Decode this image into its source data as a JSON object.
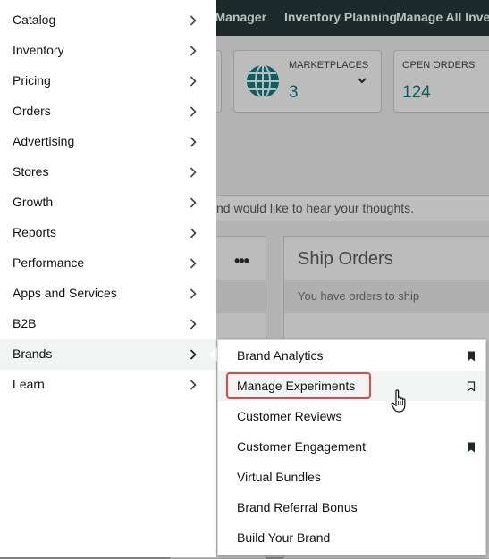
{
  "top_nav": {
    "items": [
      "n Manager",
      "Inventory Planning",
      "Manage All Invent"
    ]
  },
  "cards": [
    {
      "label": "MARKETPLACES",
      "value": "3",
      "icon": "globe-icon"
    },
    {
      "label": "OPEN ORDERS",
      "value": "124"
    }
  ],
  "notice": {
    "text": "nd would like to hear your thoughts."
  },
  "ship_orders": {
    "title": "Ship Orders",
    "subtitle": "You have orders to ship"
  },
  "more_label": "•••",
  "menu": {
    "items": [
      {
        "label": "Catalog"
      },
      {
        "label": "Inventory"
      },
      {
        "label": "Pricing"
      },
      {
        "label": "Orders"
      },
      {
        "label": "Advertising"
      },
      {
        "label": "Stores"
      },
      {
        "label": "Growth"
      },
      {
        "label": "Reports"
      },
      {
        "label": "Performance"
      },
      {
        "label": "Apps and Services"
      },
      {
        "label": "B2B"
      },
      {
        "label": "Brands",
        "active": true
      },
      {
        "label": "Learn"
      }
    ]
  },
  "submenu": {
    "items": [
      {
        "label": "Brand Analytics",
        "bookmark": "filled"
      },
      {
        "label": "Manage Experiments",
        "bookmark": "outline",
        "highlighted": true
      },
      {
        "label": "Customer Reviews"
      },
      {
        "label": "Customer Engagement",
        "bookmark": "filled"
      },
      {
        "label": "Virtual Bundles"
      },
      {
        "label": "Brand Referral Bonus"
      },
      {
        "label": "Build Your Brand"
      }
    ]
  },
  "colors": {
    "accent_teal": "#0b5e62",
    "highlight_red": "#e04848",
    "topnav": "#1c2a2b"
  }
}
